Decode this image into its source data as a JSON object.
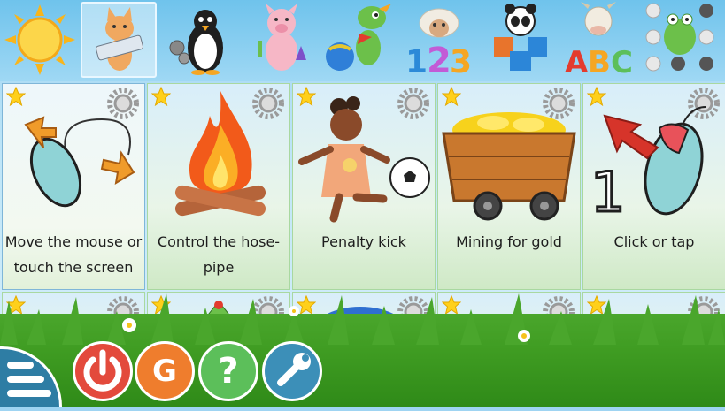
{
  "top_bar": {
    "items": [
      {
        "name": "sun-icon"
      },
      {
        "name": "cat-keyboard-icon",
        "selected": true
      },
      {
        "name": "penguin-gears-icon"
      },
      {
        "name": "pig-science-icon"
      },
      {
        "name": "dragon-ball-icon"
      },
      {
        "name": "sheep-numbers-icon"
      },
      {
        "name": "panda-puzzle-icon"
      },
      {
        "name": "cow-letters-icon"
      },
      {
        "name": "frog-dots-icon"
      }
    ],
    "number_labels": [
      "1",
      "2",
      "3"
    ],
    "letter_labels": [
      "A",
      "B",
      "C"
    ]
  },
  "activities": [
    {
      "caption": "Move the mouse or touch the screen",
      "icon": "mouse-arrows-icon"
    },
    {
      "caption": "Control the hose-pipe",
      "icon": "campfire-icon"
    },
    {
      "caption": "Penalty kick",
      "icon": "girl-football-icon"
    },
    {
      "caption": "Mining for gold",
      "icon": "gold-cart-icon"
    },
    {
      "caption": "Click or tap",
      "icon": "mouse-click-icon",
      "number": "1"
    }
  ],
  "bottom_bar": {
    "buttons": [
      {
        "name": "menu-button"
      },
      {
        "name": "quit-button"
      },
      {
        "name": "language-button",
        "label": "G"
      },
      {
        "name": "help-button",
        "label": "?"
      },
      {
        "name": "settings-button"
      }
    ]
  },
  "colors": {
    "sky": "#9ed4f2",
    "grass": "#3f9c22",
    "quit": "#e34a3c",
    "lang": "#ef7d2d",
    "help": "#5cbf5a",
    "settings": "#3c8fb8",
    "menu": "#2e7da4"
  }
}
